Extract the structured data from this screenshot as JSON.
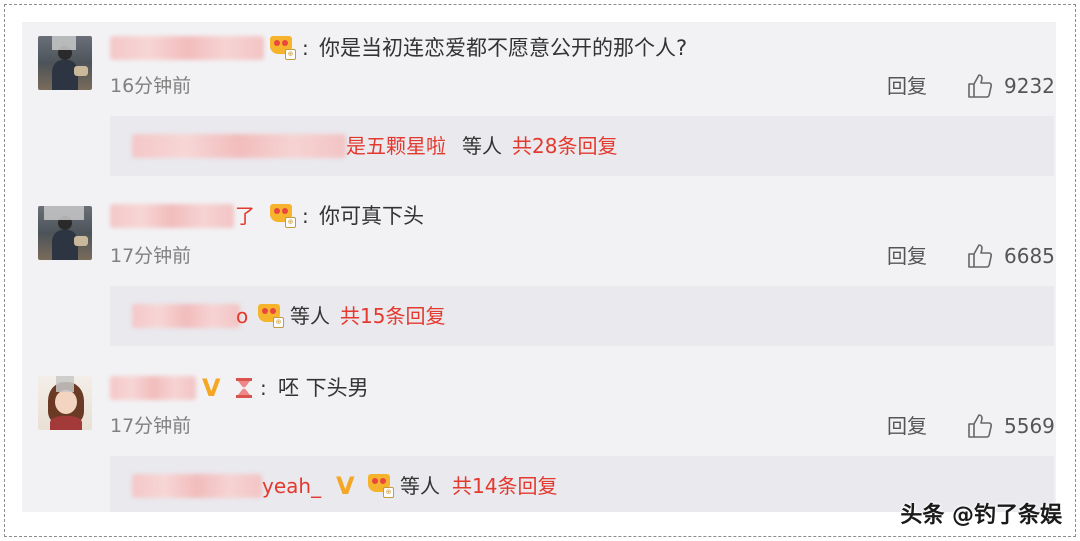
{
  "comments": [
    {
      "content": "你是当初连恋爱都不愿意公开的那个人?",
      "time": "16分钟前",
      "reply_label": "回复",
      "likes": "9232",
      "sub": {
        "name_tail": "是五颗星啦",
        "deng": "等人",
        "count": "共28条回复"
      }
    },
    {
      "name_tail": "了",
      "content": "你可真下头",
      "time": "17分钟前",
      "reply_label": "回复",
      "likes": "6685",
      "sub": {
        "name_tail": "o",
        "deng": "等人",
        "count": "共15条回复"
      }
    },
    {
      "content": "呸 下头男",
      "time": "17分钟前",
      "reply_label": "回复",
      "likes": "5569",
      "sub": {
        "name_tail": "yeah_",
        "deng": "等人",
        "count": "共14条回复"
      }
    }
  ],
  "colon": ":",
  "watermark": "头条 @钓了条娱",
  "colors": {
    "accent_red": "#e4392e",
    "vip_gold": "#f5a623",
    "panel_bg": "#f2f2f5"
  },
  "icons": [
    "crown-badge-icon",
    "vip-v-icon",
    "hourglass-badge-icon",
    "thumbs-up-icon"
  ]
}
